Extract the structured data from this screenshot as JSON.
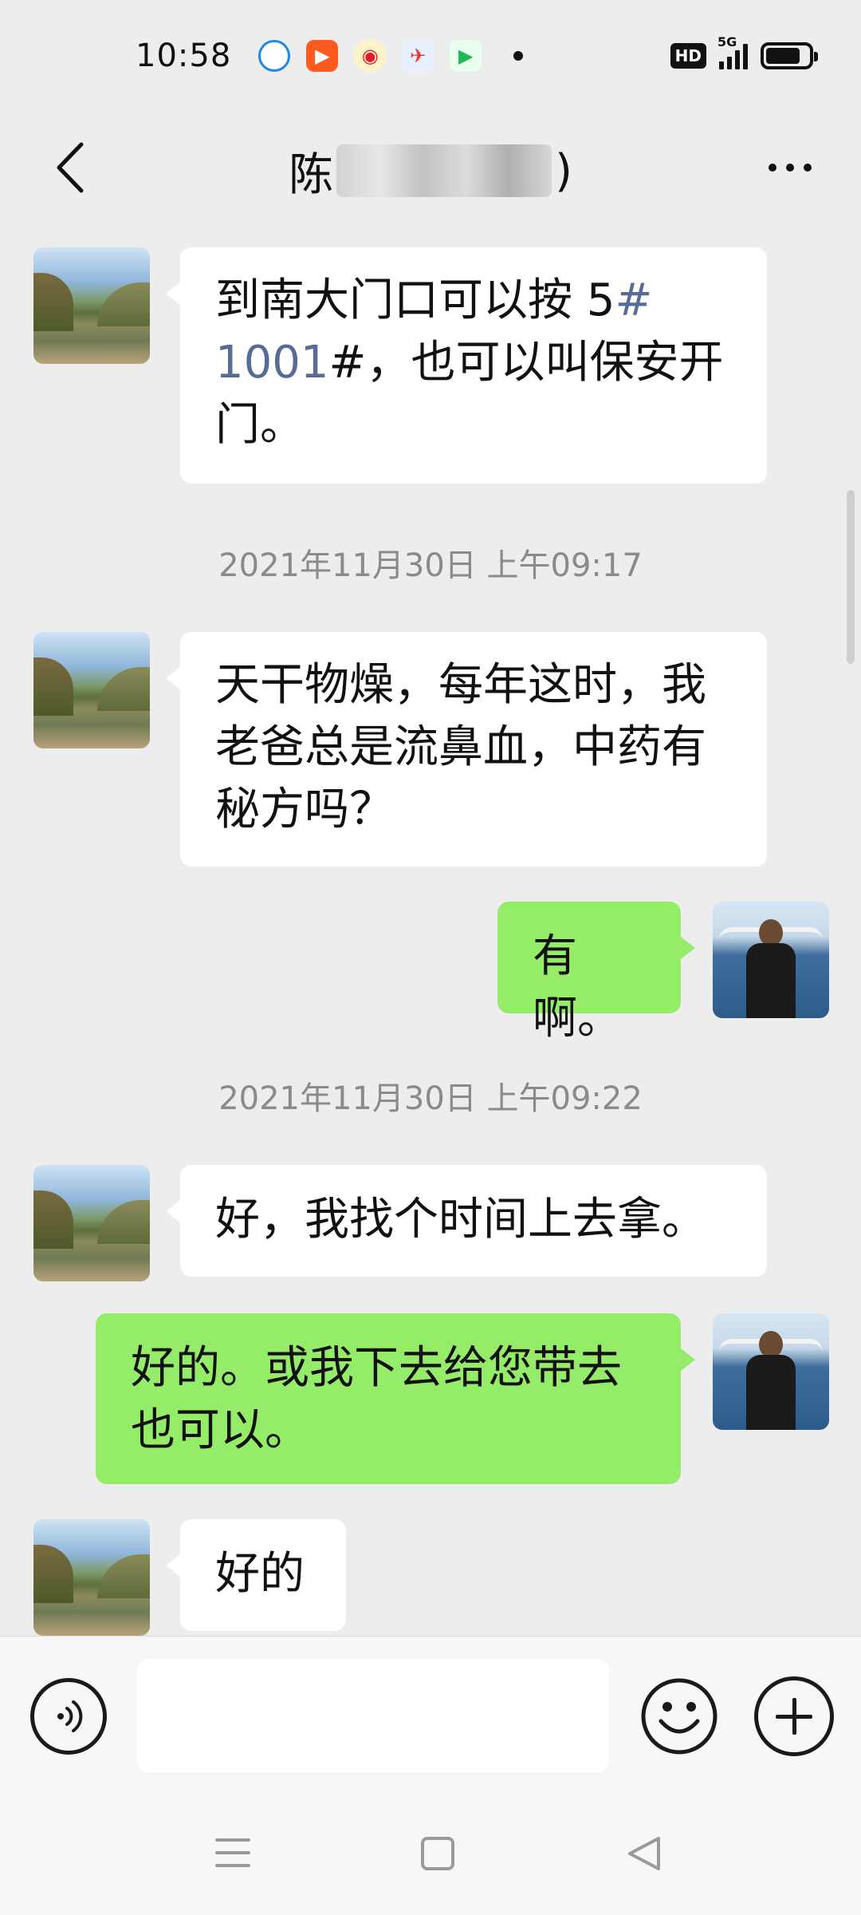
{
  "status_bar": {
    "time": "10:58",
    "hd": "HD",
    "network": "5G",
    "battery_level": 0.8,
    "app_icons": [
      "qq-browser-icon",
      "kuaishou-icon",
      "weibo-icon",
      "news-icon",
      "video-app-icon"
    ]
  },
  "header": {
    "title_prefix": "陈",
    "title_suffix": ")",
    "back_icon": "chevron-left-icon",
    "more_icon": "more-dots-icon"
  },
  "messages": [
    {
      "side": "in",
      "segments": [
        "到南大门口可以按 5",
        "#",
        "\n1001",
        "#",
        "，也可以叫保安开\n门。"
      ]
    },
    {
      "type": "timestamp",
      "text": "2021年11月30日 上午09:17"
    },
    {
      "side": "in",
      "text": "天干物燥，每年这时，我\n老爸总是流鼻血，中药有\n秘方吗？"
    },
    {
      "side": "out",
      "text": "有啊。"
    },
    {
      "type": "timestamp",
      "text": "2021年11月30日 上午09:22"
    },
    {
      "side": "in",
      "text": "好，我找个时间上去拿。"
    },
    {
      "side": "out",
      "text": "好的。或我下去给您带去\n也可以。"
    },
    {
      "side": "in",
      "text": "好的"
    }
  ],
  "input_bar": {
    "voice_icon": "voice-icon",
    "input_value": "",
    "emoji_icon": "emoji-icon",
    "plus_icon": "plus-icon"
  },
  "nav_bar": {
    "icons": [
      "menu-icon",
      "home-icon",
      "back-triangle-icon"
    ]
  },
  "colors": {
    "background": "#ededed",
    "incoming_bubble": "#ffffff",
    "outgoing_bubble": "#95ec69",
    "link_hash": "#576b95",
    "timestamp_text": "#8a8a8a"
  }
}
